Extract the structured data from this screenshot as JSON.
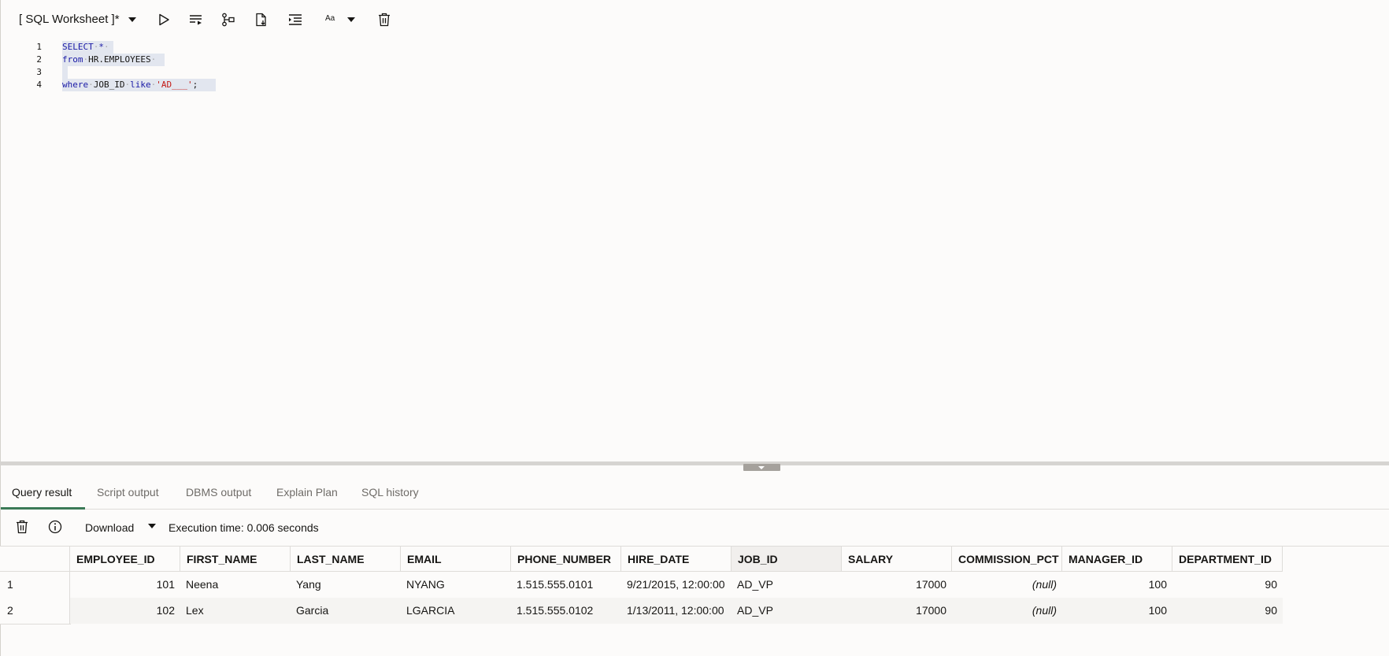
{
  "worksheet": {
    "title": "[ SQL Worksheet ]*"
  },
  "toolbar": {
    "font_size_label": "Aa",
    "buttons": [
      "run-statement",
      "run-script",
      "explain-plan",
      "autotrace",
      "format",
      "font-size",
      "clear"
    ]
  },
  "editor": {
    "lines": [
      {
        "no": "1",
        "tokens": [
          {
            "t": "SELECT",
            "c": "kw"
          },
          {
            "t": "·",
            "c": "ws"
          },
          {
            "t": "*",
            "c": "kw"
          },
          {
            "t": "·",
            "c": "ws"
          }
        ]
      },
      {
        "no": "2",
        "tokens": [
          {
            "t": "from",
            "c": "kw"
          },
          {
            "t": "·",
            "c": "ws"
          },
          {
            "t": "HR.EMPLOYEES",
            "c": "plain"
          },
          {
            "t": "·",
            "c": "ws"
          }
        ]
      },
      {
        "no": "3",
        "tokens": [
          {
            "t": " ",
            "c": "plain"
          }
        ]
      },
      {
        "no": "4",
        "tokens": [
          {
            "t": "where",
            "c": "kw"
          },
          {
            "t": "·",
            "c": "ws"
          },
          {
            "t": "JOB_ID",
            "c": "plain"
          },
          {
            "t": "·",
            "c": "ws"
          },
          {
            "t": "like",
            "c": "kw"
          },
          {
            "t": "·",
            "c": "ws"
          },
          {
            "t": "'AD___'",
            "c": "str"
          },
          {
            "t": ";",
            "c": "plain"
          }
        ]
      }
    ]
  },
  "result_tabs": [
    "Query result",
    "Script output",
    "DBMS output",
    "Explain Plan",
    "SQL history"
  ],
  "active_tab": "Query result",
  "results_toolbar": {
    "download_label": "Download",
    "execution_time": "Execution time: 0.006 seconds"
  },
  "grid": {
    "columns": [
      "EMPLOYEE_ID",
      "FIRST_NAME",
      "LAST_NAME",
      "EMAIL",
      "PHONE_NUMBER",
      "HIRE_DATE",
      "JOB_ID",
      "SALARY",
      "COMMISSION_PCT",
      "MANAGER_ID",
      "DEPARTMENT_ID"
    ],
    "rows": [
      {
        "num": "1",
        "cells": [
          "101",
          "Neena",
          "Yang",
          "NYANG",
          "1.515.555.0101",
          "9/21/2015, 12:00:00",
          "AD_VP",
          "17000",
          "(null)",
          "100",
          "90"
        ]
      },
      {
        "num": "2",
        "cells": [
          "102",
          "Lex",
          "Garcia",
          "LGARCIA",
          "1.515.555.0102",
          "1/13/2011, 12:00:00",
          "AD_VP",
          "17000",
          "(null)",
          "100",
          "90"
        ]
      }
    ]
  }
}
